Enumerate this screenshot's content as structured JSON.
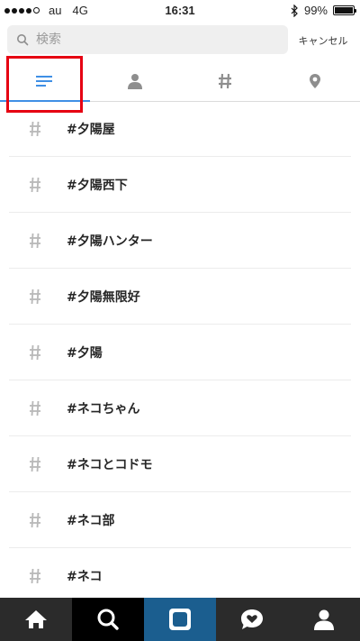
{
  "status_bar": {
    "carrier": "au",
    "network": "4G",
    "time": "16:31",
    "battery": "99%",
    "battery_level": 0.99
  },
  "search": {
    "placeholder": "検索",
    "value": "",
    "cancel_label": "キャンセル"
  },
  "tabs": [
    {
      "icon": "top-results-icon",
      "active": true
    },
    {
      "icon": "people-icon",
      "active": false
    },
    {
      "icon": "hashtag-icon",
      "active": false
    },
    {
      "icon": "location-pin-icon",
      "active": false
    }
  ],
  "results": [
    {
      "label": "#夕陽屋"
    },
    {
      "label": "#夕陽西下"
    },
    {
      "label": "#夕陽ハンター"
    },
    {
      "label": "#夕陽無限好"
    },
    {
      "label": "#夕陽"
    },
    {
      "label": "#ネコちゃん"
    },
    {
      "label": "#ネコとコドモ"
    },
    {
      "label": "#ネコ部"
    },
    {
      "label": "#ネコ"
    }
  ],
  "bottom_nav": [
    {
      "icon": "home-icon",
      "active": false
    },
    {
      "icon": "search-icon",
      "active": true
    },
    {
      "icon": "camera-icon",
      "active": false
    },
    {
      "icon": "activity-heart-icon",
      "active": false
    },
    {
      "icon": "profile-icon",
      "active": false
    }
  ],
  "colors": {
    "accent": "#3f8fe5",
    "highlight": "#e60012",
    "nav_bg": "#2b2b2b",
    "camera_bg": "#1b5e8f"
  }
}
